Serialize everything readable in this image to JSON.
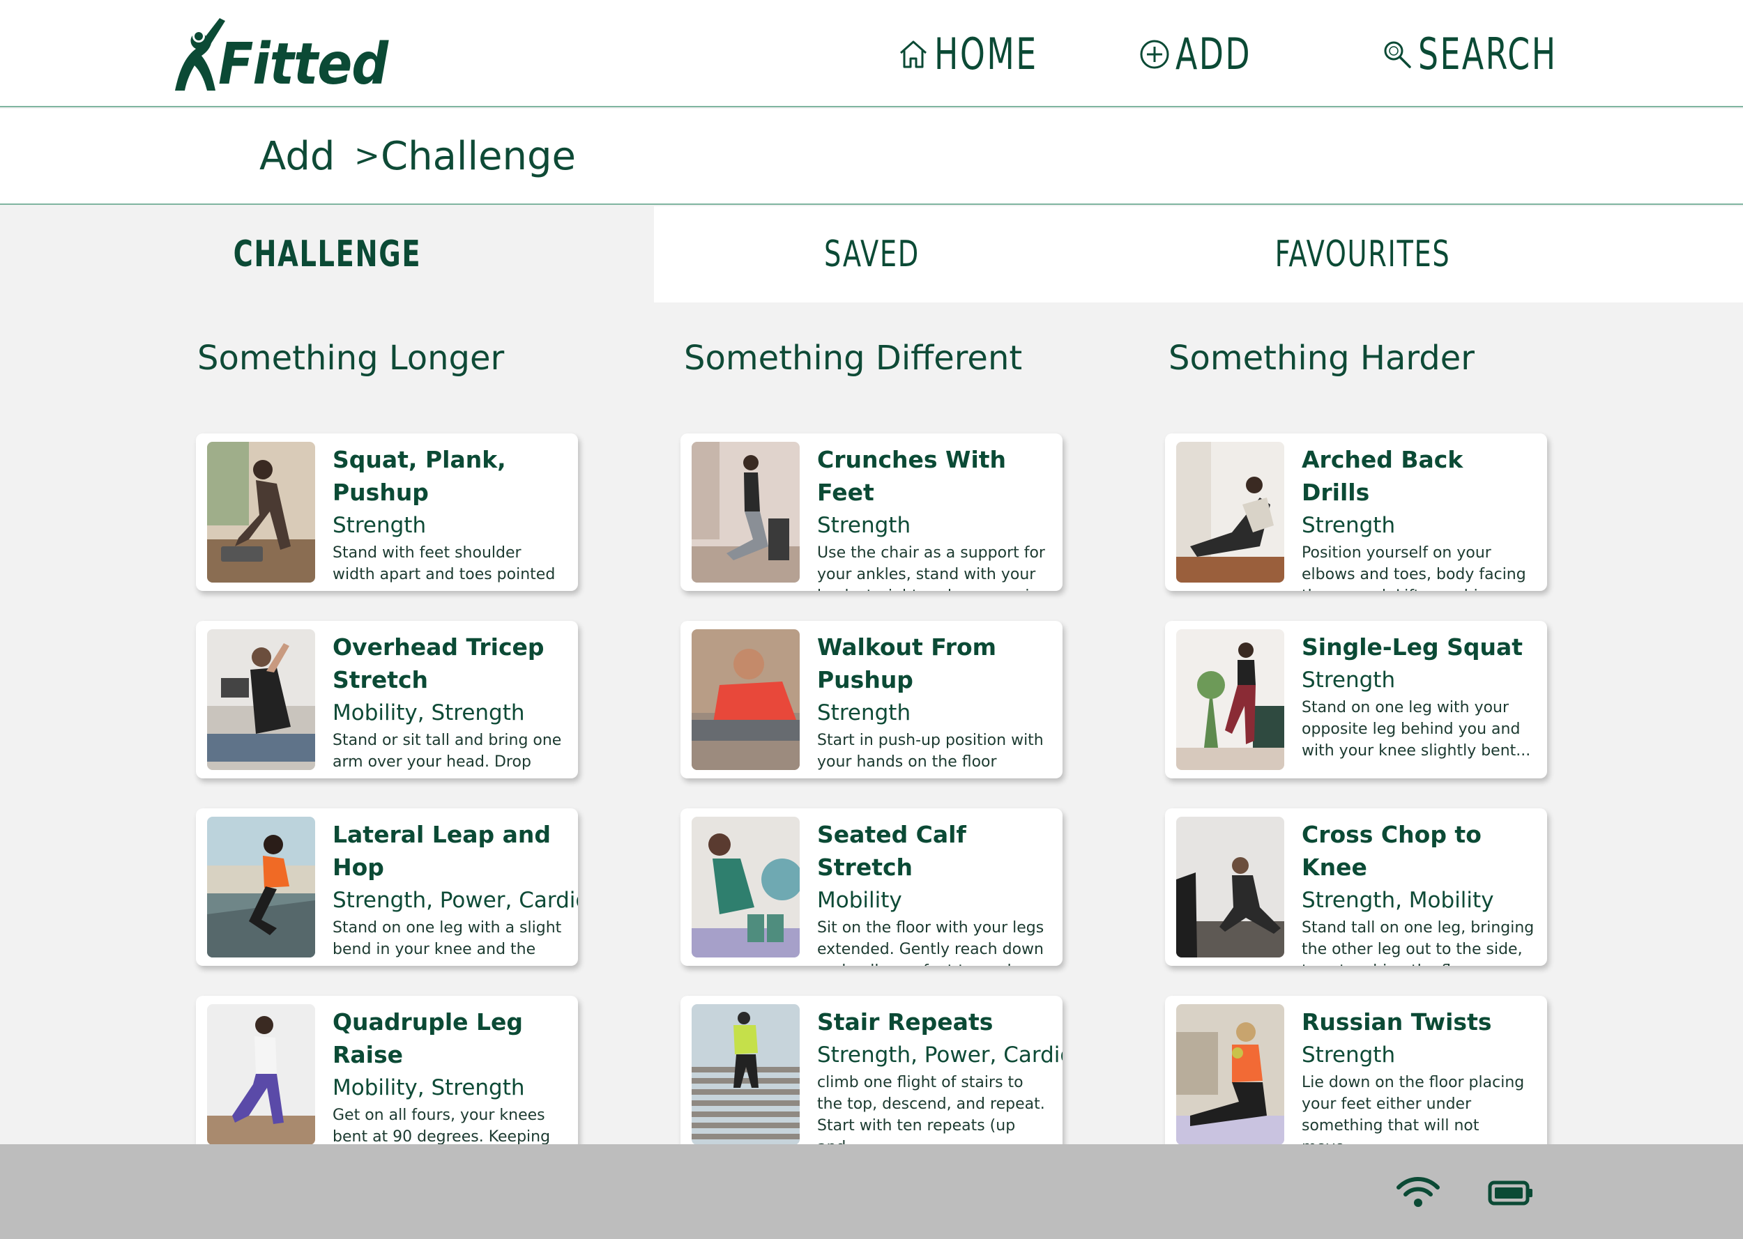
{
  "brand": {
    "name": "Fitted",
    "color": "#0b4a35"
  },
  "nav": {
    "home": {
      "label": "HOME",
      "icon": "home-icon"
    },
    "add": {
      "label": "ADD",
      "icon": "plus-circle-icon"
    },
    "search": {
      "label": "SEARCH",
      "icon": "search-icon"
    }
  },
  "breadcrumb": {
    "root": "Add",
    "separator": ">",
    "current": "Challenge"
  },
  "tabs": [
    {
      "label": "CHALLENGE",
      "active": true
    },
    {
      "label": "SAVED",
      "active": false
    },
    {
      "label": "FAVOURITES",
      "active": false
    }
  ],
  "columns": [
    {
      "title": "Something Longer",
      "cards": [
        {
          "title": "Squat, Plank, Pushup",
          "tags": "Strength",
          "desc": "Stand with feet shoulder width apart and toes pointed"
        },
        {
          "title": "Overhead Tricep Stretch",
          "tags": "Mobility, Strength",
          "desc": "Stand or sit tall and bring one arm over your head. Drop your"
        },
        {
          "title": "Lateral Leap and Hop",
          "tags": "Strength, Power, Cardio",
          "desc": "Stand on one leg with a slight bend in your knee and the"
        },
        {
          "title": "Quadruple Leg Raise",
          "tags": "Mobility, Strength",
          "desc": "Get on all fours, your knees bent at 90 degrees. Keeping the back straight so that your..."
        }
      ]
    },
    {
      "title": "Something Different",
      "cards": [
        {
          "title": "Crunches With Feet",
          "tags": "Strength",
          "desc": "Use the chair as a support for your ankles, stand with your back straight and squeeze in a"
        },
        {
          "title": "Walkout From Pushup",
          "tags": "Strength",
          "desc": "Start in push-up position with your hands on the floor"
        },
        {
          "title": "Seated Calf Stretch",
          "tags": "Mobility",
          "desc": "Sit on the floor with your legs extended. Gently reach down and pull your feet towards..."
        },
        {
          "title": "Stair Repeats",
          "tags": "Strength, Power, Cardio",
          "desc": "climb one flight of stairs to the top, descend, and repeat.  Start with ten repeats (up and..."
        }
      ]
    },
    {
      "title": "Something Harder",
      "cards": [
        {
          "title": "Arched Back Drills",
          "tags": "Strength",
          "desc": "Position yourself on your elbows and toes, body facing the ground. Lift your hips..."
        },
        {
          "title": "Single-Leg Squat",
          "tags": "Strength",
          "desc": "Stand on one leg with your opposite leg behind you and with your knee slightly bent..."
        },
        {
          "title": "Cross Chop to Knee",
          "tags": "Strength, Mobility",
          "desc": "Stand tall on one leg, bringing the other leg out to the side, toes touching the floor. Clasp..."
        },
        {
          "title": "Russian Twists",
          "tags": "Strength",
          "desc": "Lie down on the floor placing your feet either under something that will not move..."
        }
      ]
    }
  ],
  "status": {
    "wifi_icon": "wifi-icon",
    "battery_icon": "battery-icon"
  }
}
